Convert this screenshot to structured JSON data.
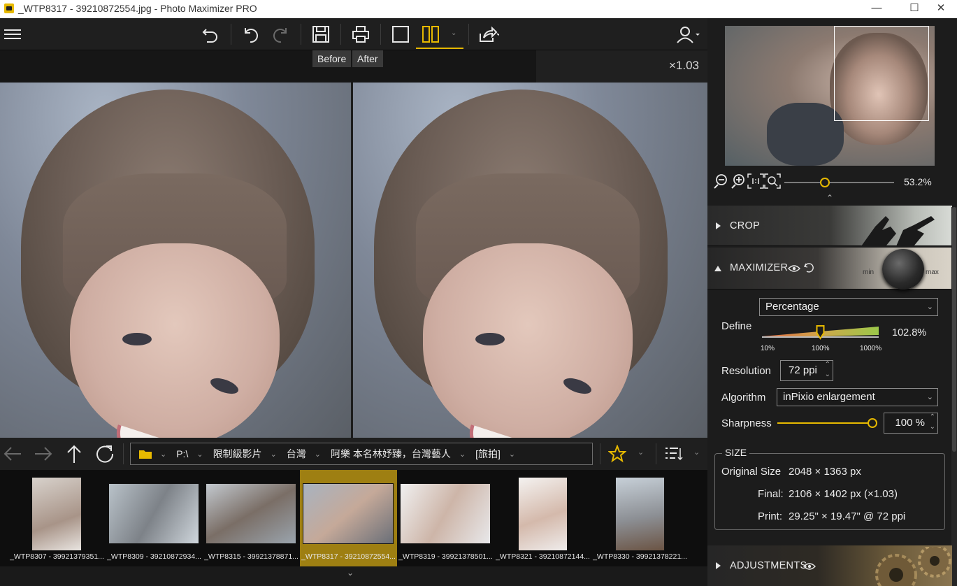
{
  "window": {
    "title": "_WTP8317 - 39210872554.jpg - Photo Maximizer PRO",
    "minimize": "—",
    "maximize": "☐",
    "close": "✕"
  },
  "toolbar": {
    "menu_icon": "hamburger-icon",
    "undo_icon": "undo-icon",
    "rotate_left_icon": "rotate-left-icon",
    "rotate_right_icon": "rotate-right-icon",
    "save_icon": "save-icon",
    "print_icon": "print-icon",
    "single_view_icon": "single-view-icon",
    "split_view_icon": "split-view-icon",
    "share_icon": "share-icon",
    "account_icon": "account-icon",
    "accent_color": "#e7b900"
  },
  "viewer": {
    "before_label": "Before",
    "after_label": "After",
    "zoom_factor": "×1.03"
  },
  "nav": {
    "crumbs": [
      "P:\\",
      "限制級影片",
      "台灣",
      "阿樂 本名林妤臻，台灣藝人",
      "[旅拍]"
    ]
  },
  "filmstrip": {
    "items": [
      {
        "caption": "_WTP8307 - 39921379351..."
      },
      {
        "caption": "_WTP8309 - 39210872934..."
      },
      {
        "caption": "_WTP8315 - 39921378871..."
      },
      {
        "caption": "_WTP8317 - 39210872554..."
      },
      {
        "caption": "_WTP8319 - 39921378501..."
      },
      {
        "caption": "_WTP8321 - 39210872144..."
      },
      {
        "caption": "_WTP8330 - 39921378221..."
      }
    ],
    "selected_index": 3
  },
  "navigator": {
    "zoom_percent": "53.2%",
    "zoom_slider_fraction": 0.37
  },
  "crop": {
    "title": "CROP"
  },
  "maximizer": {
    "title": "MAXIMIZER",
    "knob_min": "min",
    "knob_max": "max",
    "mode": "Percentage",
    "define_label": "Define",
    "define_value": "102.8%",
    "define_ticks": [
      "10%",
      "100%",
      "1000%"
    ],
    "define_fraction": 0.5,
    "resolution_label": "Resolution",
    "resolution_value": "72 ppi",
    "algorithm_label": "Algorithm",
    "algorithm_value": "inPixio enlargement",
    "sharpness_label": "Sharpness",
    "sharpness_value": "100 %",
    "sharpness_fraction": 1.0
  },
  "size": {
    "title": "SIZE",
    "original_label": "Original Size",
    "original_value": "2048 × 1363 px",
    "final_label": "Final:",
    "final_value": "2106 × 1402 px (×1.03)",
    "print_label": "Print:",
    "print_value": "29.25\" × 19.47\" @ 72 ppi"
  },
  "adjustments": {
    "title": "ADJUSTMENTS"
  }
}
